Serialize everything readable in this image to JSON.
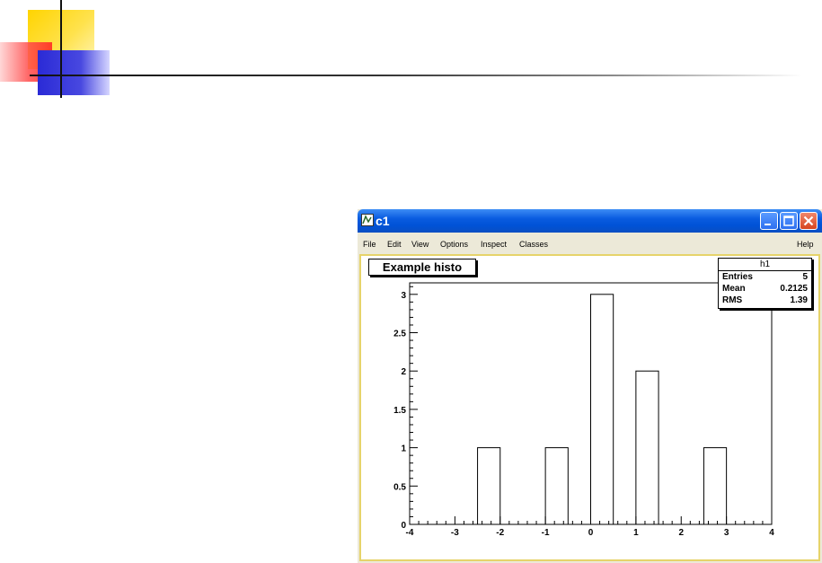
{
  "window": {
    "title": "c1",
    "titlebar_color": "#0a5ce0",
    "buttons": [
      "minimize-icon",
      "maximize-icon",
      "close-icon"
    ]
  },
  "menu": {
    "file": "File",
    "edit": "Edit",
    "view": "View",
    "options": "Options",
    "inspect": "Inspect",
    "classes": "Classes",
    "help": "Help"
  },
  "canvas": {
    "frame_color": "#e6d36a"
  },
  "histogram": {
    "title": "Example histo",
    "stats": {
      "name": "h1",
      "entries_label": "Entries",
      "entries_value": "5",
      "mean_label": "Mean",
      "mean_value": "0.2125",
      "rms_label": "RMS",
      "rms_value": "1.39"
    }
  },
  "chart_data": {
    "type": "bar",
    "title": "Example histo",
    "xlim": [
      -4,
      4
    ],
    "ylim": [
      0,
      3.15
    ],
    "x_ticks": [
      "-4",
      "-3",
      "-2",
      "-1",
      "0",
      "1",
      "2",
      "3",
      "4"
    ],
    "y_ticks": [
      "0",
      "0.5",
      "1",
      "1.5",
      "2",
      "2.5",
      "3"
    ],
    "bins": [
      {
        "x0": -2.5,
        "x1": -2.0,
        "value": 1
      },
      {
        "x0": -1.0,
        "x1": -0.5,
        "value": 1
      },
      {
        "x0": 0.0,
        "x1": 0.5,
        "value": 3
      },
      {
        "x0": 1.0,
        "x1": 1.5,
        "value": 2
      },
      {
        "x0": 2.5,
        "x1": 3.0,
        "value": 1
      }
    ],
    "grid": false,
    "legend": "none"
  }
}
